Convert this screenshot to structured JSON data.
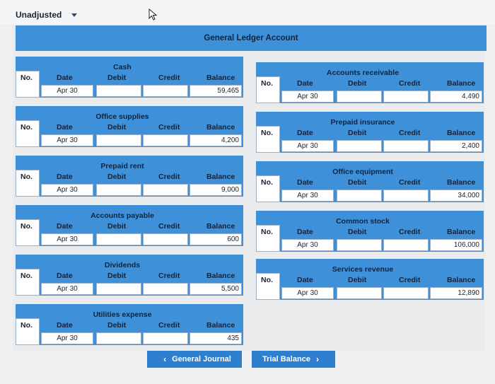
{
  "view_selector": {
    "label": "Unadjusted"
  },
  "ledger_title": "General Ledger Account",
  "column_labels": {
    "no": "No.",
    "date": "Date",
    "debit": "Debit",
    "credit": "Credit",
    "balance": "Balance"
  },
  "accounts": [
    {
      "name": "Cash",
      "date": "Apr 30",
      "debit": "",
      "credit": "",
      "balance": "59,465"
    },
    {
      "name": "Accounts receivable",
      "date": "Apr 30",
      "debit": "",
      "credit": "",
      "balance": "4,490"
    },
    {
      "name": "Office supplies",
      "date": "Apr 30",
      "debit": "",
      "credit": "",
      "balance": "4,200"
    },
    {
      "name": "Prepaid insurance",
      "date": "Apr 30",
      "debit": "",
      "credit": "",
      "balance": "2,400"
    },
    {
      "name": "Prepaid rent",
      "date": "Apr 30",
      "debit": "",
      "credit": "",
      "balance": "9,000"
    },
    {
      "name": "Office equipment",
      "date": "Apr 30",
      "debit": "",
      "credit": "",
      "balance": "34,000"
    },
    {
      "name": "Accounts payable",
      "date": "Apr 30",
      "debit": "",
      "credit": "",
      "balance": "600"
    },
    {
      "name": "Common stock",
      "date": "Apr 30",
      "debit": "",
      "credit": "",
      "balance": "106,000"
    },
    {
      "name": "Dividends",
      "date": "Apr 30",
      "debit": "",
      "credit": "",
      "balance": "5,500"
    },
    {
      "name": "Services revenue",
      "date": "Apr 30",
      "debit": "",
      "credit": "",
      "balance": "12,890"
    },
    {
      "name": "Utilities expense",
      "date": "Apr 30",
      "debit": "",
      "credit": "",
      "balance": "435"
    }
  ],
  "nav": {
    "prev_label": "General Journal",
    "next_label": "Trial Balance"
  },
  "colors": {
    "header_blue": "#3e90d9",
    "button_blue": "#2f7fd0"
  }
}
